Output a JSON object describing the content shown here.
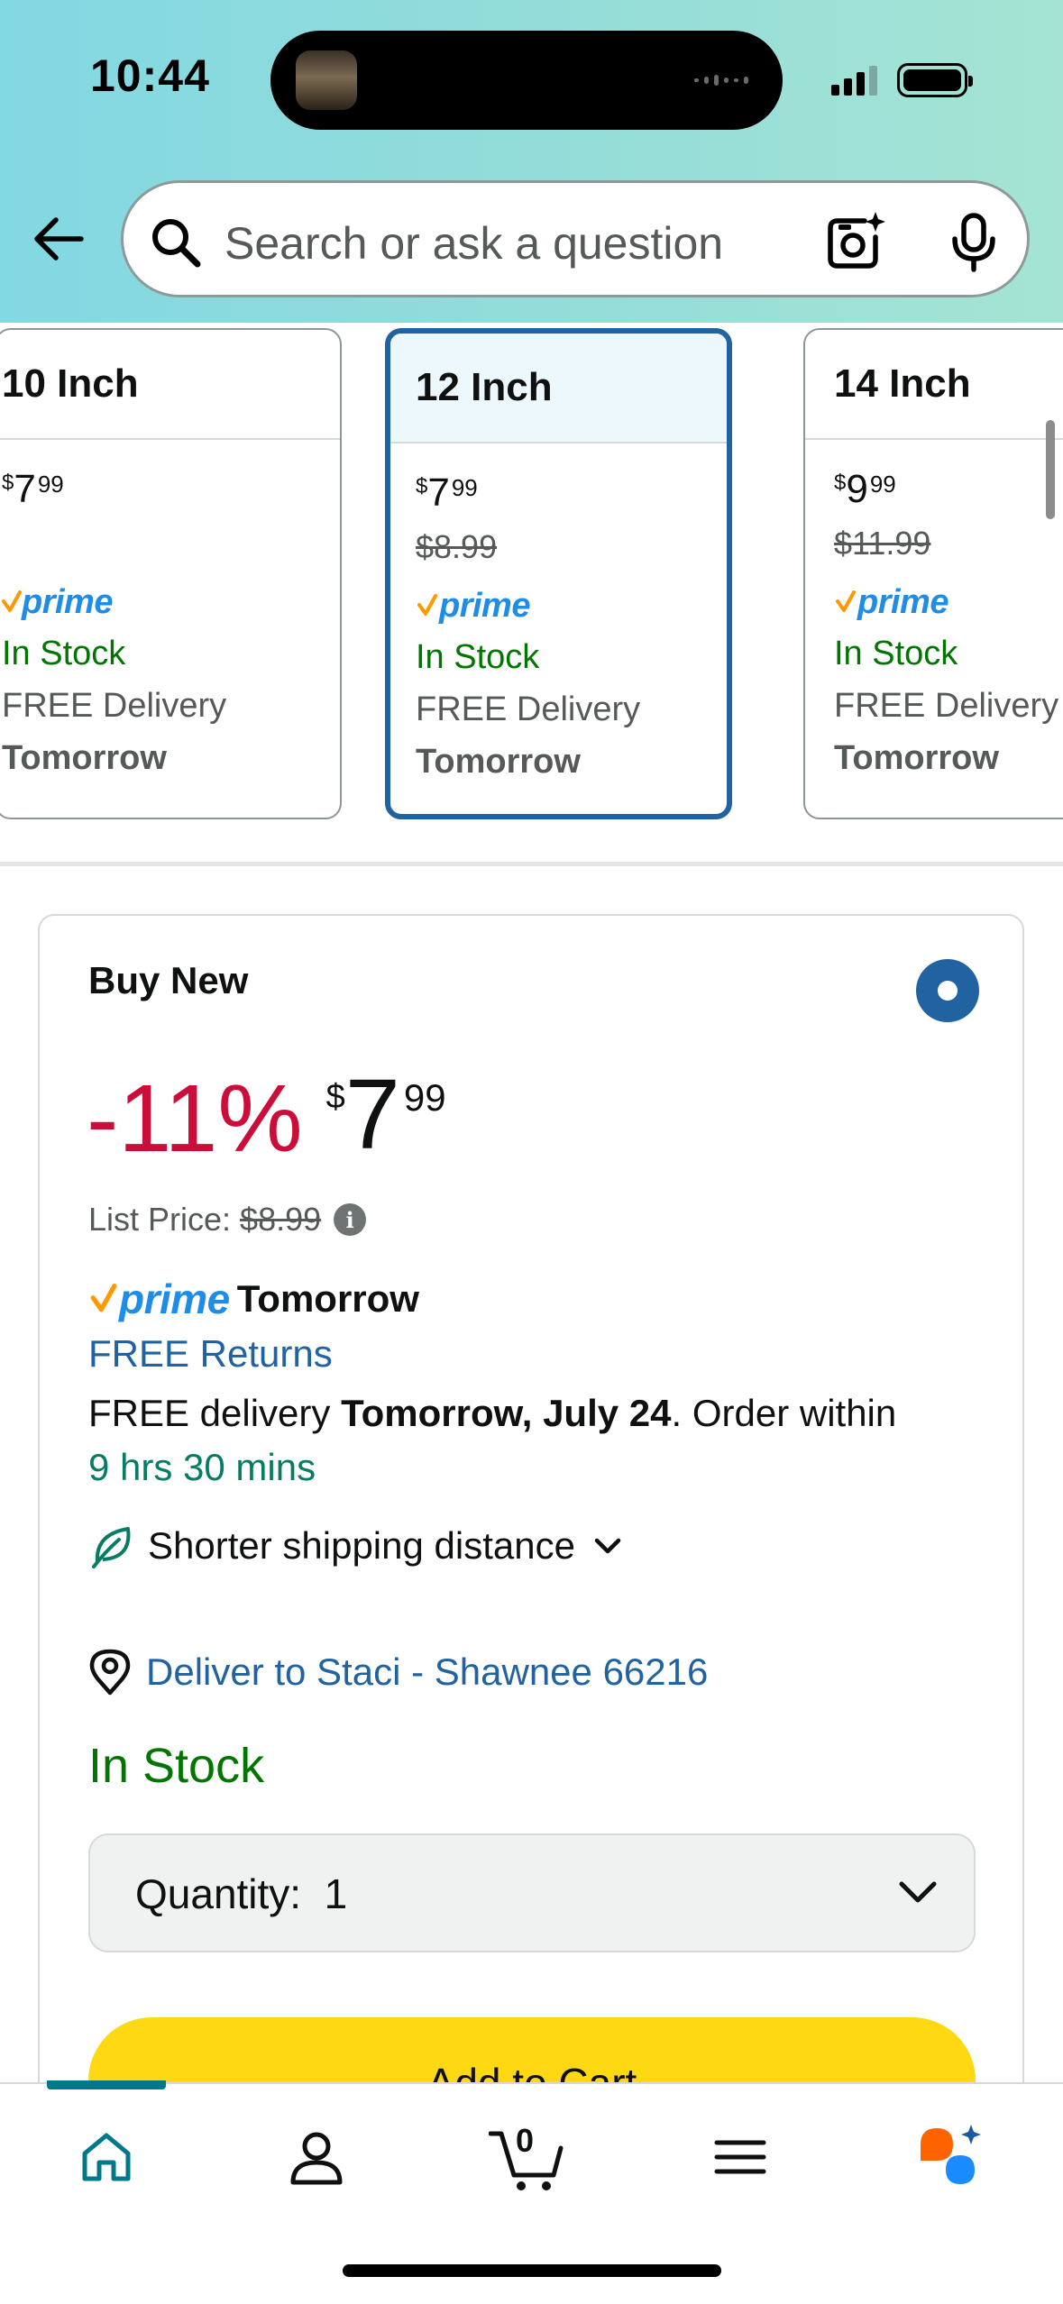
{
  "status_bar": {
    "time": "10:44"
  },
  "search": {
    "placeholder": "Search or ask a question"
  },
  "size_options": [
    {
      "label": "10 Inch",
      "price_symbol": "$",
      "price_whole": "7",
      "price_cents": "99",
      "list_price": "",
      "prime": "prime",
      "stock": "In Stock",
      "delivery": "FREE Delivery",
      "delivery_day": "Tomorrow",
      "selected": false
    },
    {
      "label": "12 Inch",
      "price_symbol": "$",
      "price_whole": "7",
      "price_cents": "99",
      "list_price": "$8.99",
      "prime": "prime",
      "stock": "In Stock",
      "delivery": "FREE Delivery",
      "delivery_day": "Tomorrow",
      "selected": true
    },
    {
      "label": "14 Inch",
      "price_symbol": "$",
      "price_whole": "9",
      "price_cents": "99",
      "list_price": "$11.99",
      "prime": "prime",
      "stock": "In Stock",
      "delivery": "FREE Delivery",
      "delivery_day": "Tomorrow",
      "selected": false
    }
  ],
  "buy_box": {
    "title": "Buy New",
    "discount": "-11%",
    "price_symbol": "$",
    "price_whole": "7",
    "price_cents": "99",
    "list_price_label": "List Price:",
    "list_price": "$8.99",
    "prime_word": "prime",
    "prime_day": "Tomorrow",
    "returns": "FREE Returns",
    "delivery_prefix": "FREE delivery ",
    "delivery_date": "Tomorrow, July 24",
    "delivery_suffix": ". Order within",
    "order_within": "9 hrs 30 mins",
    "eco_label": "Shorter shipping distance",
    "deliver_to": "Deliver to Staci - Shawnee 66216",
    "stock_status": "In Stock",
    "quantity_label": "Quantity:",
    "quantity_value": "1",
    "add_to_cart": "Add to Cart"
  },
  "bottom_nav": {
    "cart_count": "0"
  },
  "colors": {
    "accent_blue": "#2162a1",
    "deal_red": "#cc0c39",
    "stock_green": "#007600",
    "cart_button_yellow": "#ffd814",
    "prime_blue": "#1f8ce6",
    "prime_orange": "#ff9900"
  }
}
